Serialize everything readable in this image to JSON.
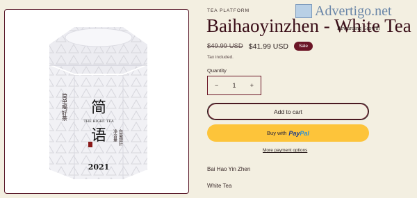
{
  "product": {
    "vendor": "TEA PLATFORM",
    "title": "Baihaoyinzhen - White Tea",
    "old_price": "$49.99 USD",
    "new_price": "$41.99 USD",
    "badge": "Sale",
    "tax_note": "Tax included.",
    "quantity_label": "Quantity",
    "quantity_value": "1",
    "minus_symbol": "−",
    "plus_symbol": "+",
    "add_to_cart": "Add to cart",
    "buy_with": "Buy with",
    "paypal_a": "Pay",
    "paypal_b": "Pal",
    "more_payment": "More payment options",
    "desc_line1": "Bai Hao Yin Zhen",
    "desc_line2": "White Tea"
  },
  "package": {
    "side_text": "简单喝好茶",
    "char1": "简",
    "char2": "语",
    "subtitle": "THE HIGHT TEA",
    "year": "2021",
    "right_text1": "净含量",
    "right_text2": "白毫银针"
  },
  "watermark": {
    "brand": "Advertigo.net",
    "tagline": "Rewarding Growth"
  },
  "colors": {
    "background": "#f3efe1",
    "accent": "#6b1526",
    "paypal_button": "#fdc43a"
  }
}
